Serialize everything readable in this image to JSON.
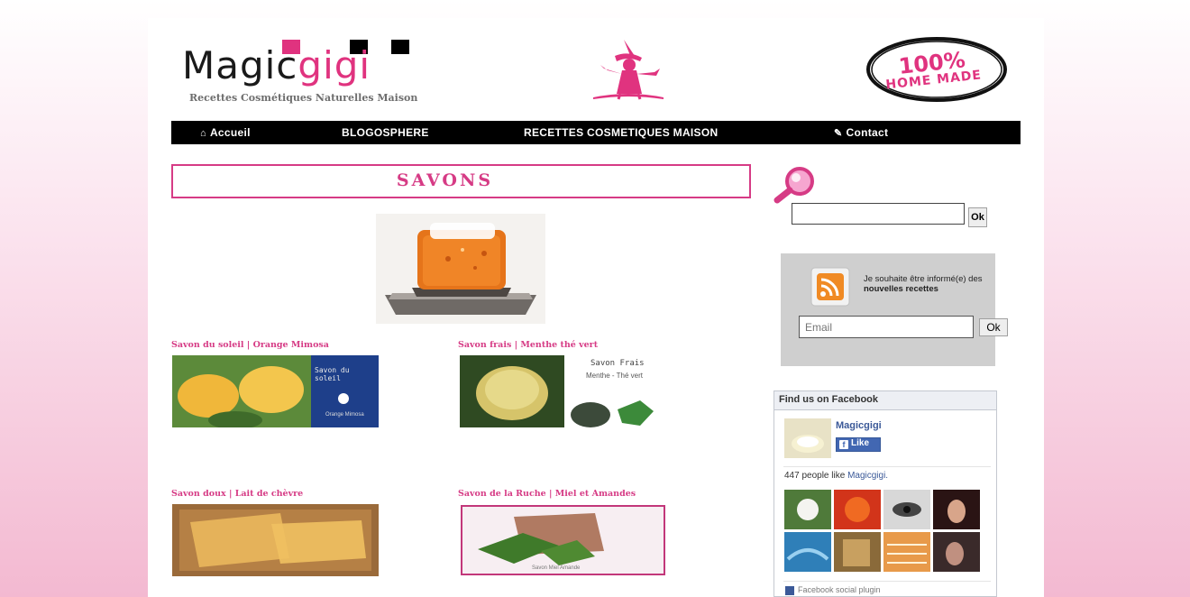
{
  "header": {
    "logo_main": "Magic",
    "logo_accent": "gigi",
    "tagline": "Recettes Cosmétiques Naturelles Maison",
    "badge_line1": "100%",
    "badge_line2": "HOME MADE"
  },
  "nav": {
    "items": [
      {
        "label": "Accueil",
        "icon": "home-icon"
      },
      {
        "label": "BLOGOSPHERE"
      },
      {
        "label": "RECETTES COSMETIQUES MAISON"
      },
      {
        "label": "Contact",
        "icon": "pencil-icon"
      }
    ]
  },
  "main": {
    "title": "SAVONS",
    "posts": [
      {
        "title": "Savon du soleil | Orange Mimosa",
        "thumb_caption": "Savon du soleil",
        "thumb_sub": "Orange Mimosa"
      },
      {
        "title": "Savon frais | Menthe thé vert",
        "thumb_caption": "Savon Frais",
        "thumb_sub": "Menthe - Thé vert"
      },
      {
        "title": "Savon doux | Lait de chèvre"
      },
      {
        "title": "Savon de la Ruche | Miel et Amandes",
        "thumb_caption": "Savon Miel Amande"
      }
    ]
  },
  "sidebar": {
    "search_button": "Ok",
    "newsletter_text": "Je souhaite être informé(e) des",
    "newsletter_bold": "nouvelles recettes",
    "email_placeholder": "Email",
    "newsletter_button": "Ok",
    "facebook": {
      "header": "Find us on Facebook",
      "page_name": "Magicgigi",
      "like_label": "Like",
      "count_text": "447 people like",
      "count_link": "Magicgigi.",
      "footer": "Facebook social plugin"
    }
  },
  "colors": {
    "accent_pink": "#d63b85",
    "nav_bg": "#000000",
    "fb_blue": "#3b5998"
  }
}
